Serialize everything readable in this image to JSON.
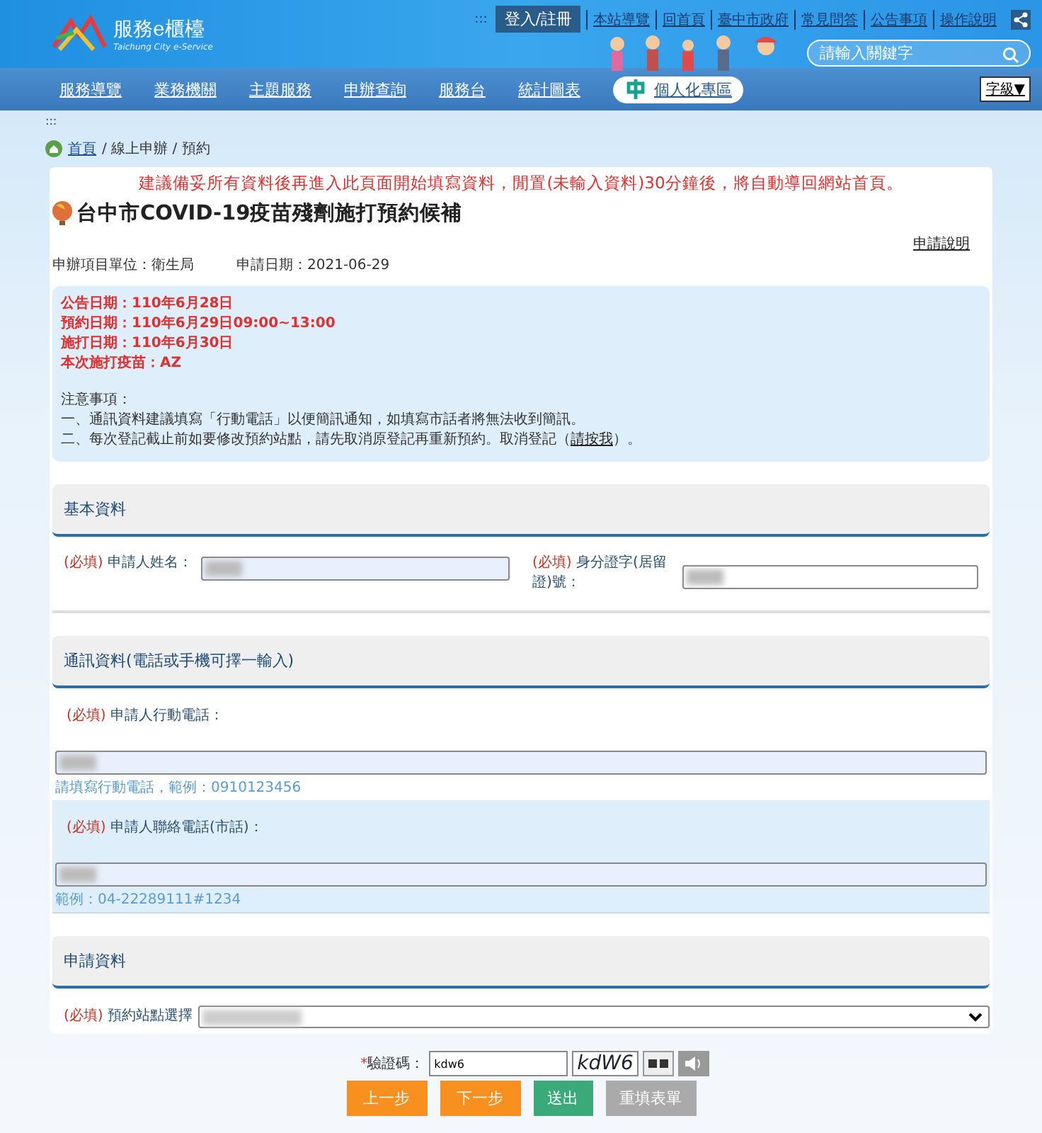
{
  "header": {
    "logo_title": "服務e櫃檯",
    "logo_subtitle": "Taichung City e-Service",
    "skip_link": ":::",
    "login": "登入/註冊",
    "top_links": [
      "本站導覽",
      "回首頁",
      "臺中市政府",
      "常見問答",
      "公告事項",
      "操作說明"
    ],
    "search": {
      "placeholder": "請輸入關鍵字"
    }
  },
  "nav": {
    "items": [
      "服務導覽",
      "業務機關",
      "主題服務",
      "申辦查詢",
      "服務台",
      "統計圖表"
    ],
    "personal": "個人化專區",
    "font_size": "字級▼"
  },
  "sub_skip_link": ":::",
  "breadcrumb": {
    "home": "首頁",
    "trail": "/ 線上申辦 / 預約"
  },
  "notice": "建議備妥所有資料後再進入此頁面開始填寫資料，閒置(未輸入資料)30分鐘後，將自動導回網站首頁。",
  "title": "台中市COVID-19疫苗殘劑施打預約候補",
  "help_link": "申請說明",
  "meta": [
    "申辦項目單位：衛生局",
    "申請日期：2021-06-29"
  ],
  "info_lines": [
    "公告日期：110年6月28日",
    "預約日期：110年6月29日09:00~13:00",
    "施打日期：110年6月30日",
    "本次施打疫苗：AZ"
  ],
  "notes_heading": "注意事項：",
  "notes": [
    {
      "before": "一、通訊資料建議填寫「行動電話」以便簡訊通知，如填寫市話者將無法收到簡訊。"
    },
    {
      "before": "二、每次登記截止前如要修改預約站點，請先取消原登記再重新預約。取消登記（",
      "link": "請按我",
      "after": "）。"
    }
  ],
  "sections": [
    {
      "title": "基本資料",
      "kind": "pair",
      "fields": [
        {
          "required": "(必填)",
          "label": "申請人姓名："
        },
        {
          "required": "(必填)",
          "label": "身分證字(居留證)號："
        }
      ]
    },
    {
      "title": "通訊資料(電話或手機可擇一輸入)",
      "kind": "stack",
      "fields": [
        {
          "required": "(必填)",
          "label": "申請人行動電話：",
          "hint": "請填寫行動電話，範例：0910123456",
          "shaded": false
        },
        {
          "required": "(必填)",
          "label": "申請人聯絡電話(市話)：",
          "hint": "範例：04-22289111#1234",
          "shaded": true
        }
      ]
    },
    {
      "title": "申請資料",
      "kind": "select",
      "fields": [
        {
          "required": "(必填)",
          "label": "預約站點選擇"
        }
      ]
    }
  ],
  "captcha": {
    "star": "*",
    "label": "驗證碼：",
    "value": "kdw6",
    "image_text": "kdW6"
  },
  "buttons": [
    {
      "label": "上一步",
      "kind": "orange"
    },
    {
      "label": "下一步",
      "kind": "orange"
    },
    {
      "label": "送出",
      "kind": "green"
    },
    {
      "label": "重填表單",
      "kind": "grey"
    }
  ]
}
